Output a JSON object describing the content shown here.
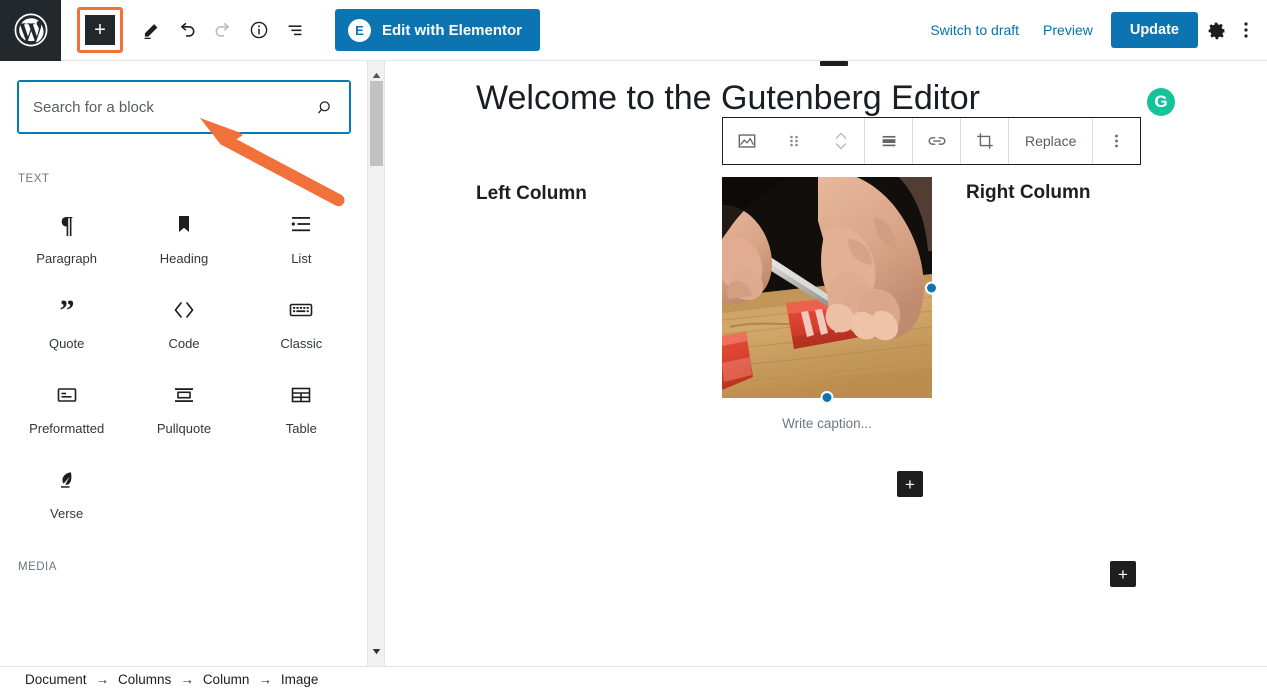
{
  "topbar": {
    "logo": "wordpress-logo",
    "inserter_label": "+",
    "tools": [
      {
        "name": "edit-pen-icon",
        "title": "Tools"
      },
      {
        "name": "undo-icon",
        "title": "Undo"
      },
      {
        "name": "redo-icon",
        "title": "Redo"
      },
      {
        "name": "info-icon",
        "title": "Details"
      },
      {
        "name": "block-navigation-icon",
        "title": "Block navigation"
      }
    ],
    "elementor_button": "Edit with Elementor",
    "elementor_badge": "E",
    "switch_to_draft": "Switch to draft",
    "preview": "Preview",
    "update": "Update",
    "settings_icon": "gear-icon",
    "more_icon": "ellipsis-vertical-icon",
    "accent_blue": "#0d74b2",
    "link_blue": "#0073aa",
    "logo_bg": "#23282d",
    "highlight_orange": "#f2703a"
  },
  "inserter_panel": {
    "search": {
      "value": "",
      "placeholder": "Search for a block",
      "icon": "search-icon",
      "focus_color": "#007cba"
    },
    "categories": [
      {
        "label": "TEXT",
        "blocks": [
          {
            "label": "Paragraph",
            "icon": "paragraph-icon"
          },
          {
            "label": "Heading",
            "icon": "heading-icon"
          },
          {
            "label": "List",
            "icon": "list-icon"
          },
          {
            "label": "Quote",
            "icon": "quote-icon"
          },
          {
            "label": "Code",
            "icon": "code-icon"
          },
          {
            "label": "Classic",
            "icon": "classic-keyboard-icon"
          },
          {
            "label": "Preformatted",
            "icon": "preformatted-icon"
          },
          {
            "label": "Pullquote",
            "icon": "pullquote-icon"
          },
          {
            "label": "Table",
            "icon": "table-icon"
          },
          {
            "label": "Verse",
            "icon": "verse-feather-icon"
          }
        ]
      },
      {
        "label": "MEDIA",
        "blocks": []
      }
    ],
    "scrollbar": {
      "up": "scroll-up-arrow",
      "down": "scroll-down-arrow"
    }
  },
  "annotation": {
    "arrow": "orange-pointer-arrow",
    "color": "#f2703a"
  },
  "editor": {
    "post_title": "Welcome to the Gutenberg Editor",
    "block_toolbar": [
      {
        "name": "image-block-icon",
        "label": ""
      },
      {
        "name": "drag-handle-icon",
        "label": ""
      },
      {
        "name": "move-up-down-icon",
        "label": ""
      },
      {
        "name": "align-icon",
        "label": ""
      },
      {
        "name": "link-icon",
        "label": ""
      },
      {
        "name": "crop-icon",
        "label": ""
      },
      {
        "name": "replace-button",
        "label": "Replace"
      },
      {
        "name": "more-options-icon",
        "label": ""
      }
    ],
    "replace_label": "Replace",
    "columns": {
      "left_label": "Left Column",
      "right_label": "Right Column"
    },
    "image": {
      "alt": "Hands slicing raw tuna on a wooden cutting board",
      "caption_placeholder": "Write caption...",
      "handle_color": "#0d74b2"
    },
    "add_block_label": "+",
    "grammarly_badge": "G",
    "grammarly_color": "#15c39a"
  },
  "footer": {
    "breadcrumb": [
      "Document",
      "Columns",
      "Column",
      "Image"
    ],
    "separator": "→"
  }
}
